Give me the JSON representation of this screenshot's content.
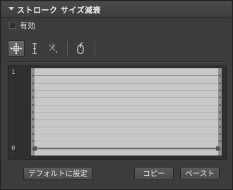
{
  "panel": {
    "title": "ストローク サイズ減衰"
  },
  "enable": {
    "label": "有効",
    "checked": false
  },
  "toolbar": {
    "tools": [
      {
        "icon": "move-point-icon",
        "active": true
      },
      {
        "icon": "insert-point-icon",
        "active": false
      },
      {
        "icon": "delete-point-icon",
        "active": false
      },
      {
        "icon": "mouse-icon",
        "active": false
      }
    ]
  },
  "curve": {
    "y_top_label": "1",
    "y_bottom_label": "0"
  },
  "buttons": {
    "reset_label": "デフォルトに設定",
    "copy_label": "コピー",
    "paste_label": "ペースト"
  },
  "colors": {
    "panel_bg": "#3c3c3c",
    "graph_bg": "#c8c8c8",
    "curve_line": "#6f6f6f"
  }
}
